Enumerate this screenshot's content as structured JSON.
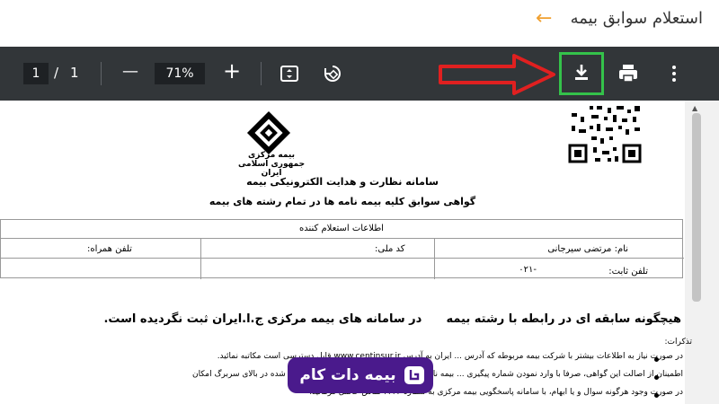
{
  "header": {
    "title": "استعلام سوابق بیمه",
    "back_arrow": "←"
  },
  "toolbar": {
    "current_page": "1",
    "page_sep": "/",
    "total_pages": "1",
    "zoom_out": "—",
    "zoom_level": "71%",
    "zoom_in": "+",
    "icons": [
      "fit-page-icon",
      "rotate-icon",
      "download-icon",
      "print-icon",
      "more-vert-icon"
    ],
    "highlight_color": "#34c24a",
    "arrow_color": "#e02020"
  },
  "document": {
    "logo_text_1": "بیمه مرکزی",
    "logo_text_2": "جمهوری اسلامی ایران",
    "title_1": "سامانه نظارت و هدایت الکترونیکی بیمه",
    "title_2": "گواهی سوابق کلیه بیمه نامه ها در تمام رشته های بیمه",
    "table": {
      "header": "اطلاعات استعلام کننده",
      "name_label": "نام: مرتضی سیرجانی",
      "national_code_label": "کد ملی:",
      "mobile_label": "تلفن همراه:",
      "phone_label": "تلفن ثابت:",
      "phone_value": "-۰۲۱"
    },
    "message_part1": "هیچگونه سابقه ای در رابطه با رشته بیمه",
    "message_part2": "در سامانه های بیمه مرکزی ج.ا.ایران ثبت نگردیده است.",
    "notes_title": "تذکرات:",
    "notes": [
      "در صورت نیاز به اطلاعات بیشتر با شرکت بیمه مربوطه که آدرس ... ایران به آدرس www.centinsur.ir قابل دسترسی است مکاتبه نمائید.",
      "اطمینان از اصالت این گواهی، صرفا با وارد نمودن شماره پیگیری ... بیمه نامه و یا از طریق اسکن کد (QR code) درج شده در بالای سربرگ امکان",
      "در صورت وجود هرگونه سوال و یا ابهام، با سامانه پاسخگویی بیمه مرکزی به شماره ۲۳۴۲ تماس حاصل فرمائید."
    ]
  },
  "watermark": {
    "brand_text": "بیمه دات کام",
    "brand_color": "#4a1a8c"
  }
}
